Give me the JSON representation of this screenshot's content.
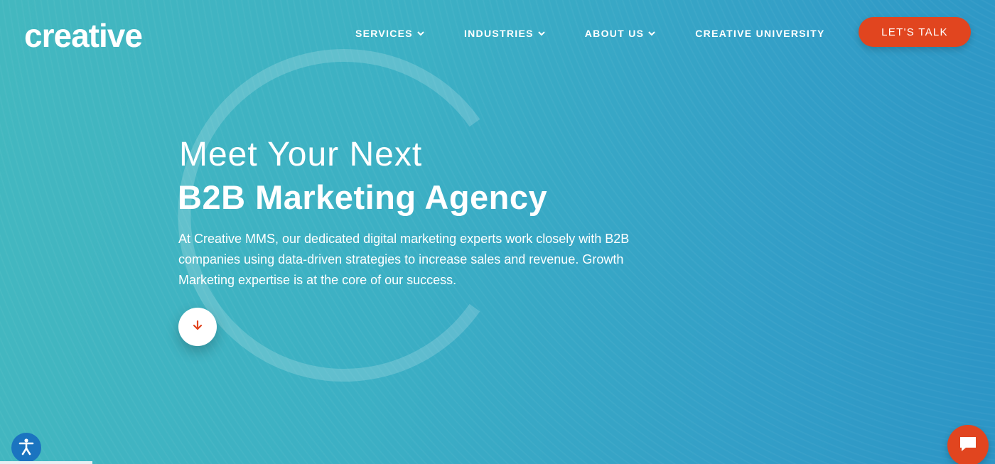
{
  "brand": {
    "logo_text": "creative",
    "accent_color": "#e1451f",
    "hero_color": "#3cb0c4"
  },
  "nav": {
    "items": [
      {
        "label": "SERVICES",
        "has_dropdown": true
      },
      {
        "label": "INDUSTRIES",
        "has_dropdown": true
      },
      {
        "label": "ABOUT US",
        "has_dropdown": true
      },
      {
        "label": "CREATIVE UNIVERSITY",
        "has_dropdown": false
      }
    ],
    "cta_label": "LET'S TALK"
  },
  "hero": {
    "headline_light": "Meet Your Next",
    "headline_bold": "B2B Marketing Agency",
    "intro": "At Creative MMS, our dedicated digital marketing experts work closely with B2B companies using data-driven strategies to increase sales and revenue. Growth Marketing expertise is at the core of our success.",
    "scroll_icon": "arrow-down-icon"
  },
  "widgets": {
    "accessibility_icon": "accessibility-icon",
    "chat_icon": "chat-bubble-icon"
  }
}
